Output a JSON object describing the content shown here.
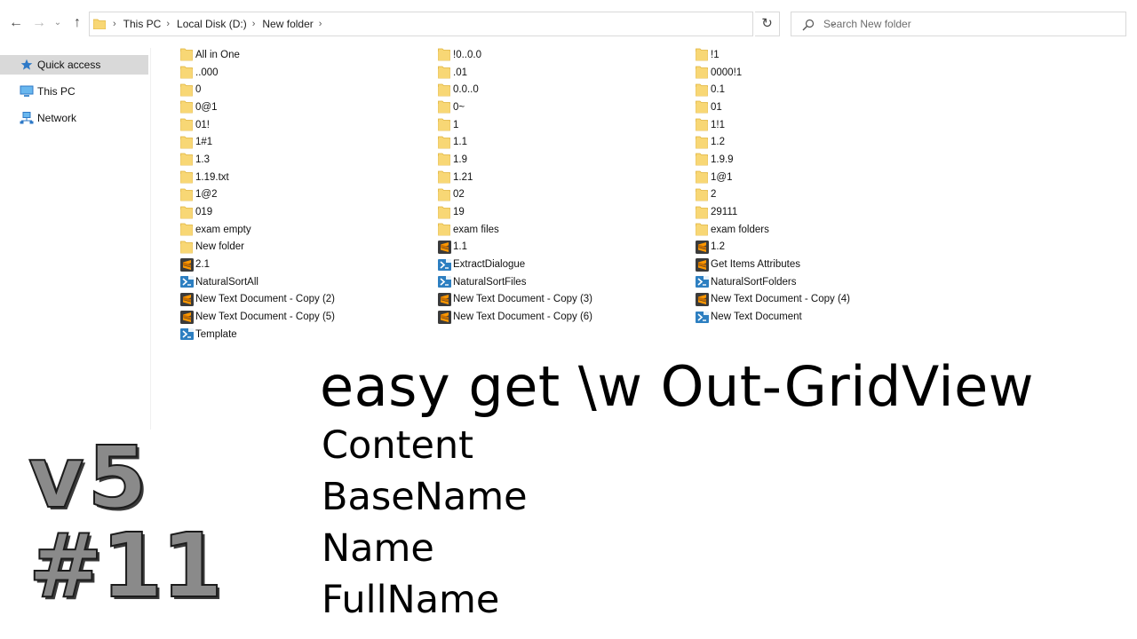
{
  "address_bar": {
    "breadcrumbs": [
      "This PC",
      "Local Disk (D:)",
      "New folder"
    ],
    "search_placeholder": "Search New folder"
  },
  "nav_pane": {
    "items": [
      {
        "label": "Quick access",
        "icon": "star-icon",
        "selected": true
      },
      {
        "label": "This PC",
        "icon": "computer-icon",
        "selected": false
      },
      {
        "label": "Network",
        "icon": "network-icon",
        "selected": false
      }
    ]
  },
  "files": {
    "columns": [
      [
        {
          "name": "All in One",
          "type": "folder"
        },
        {
          "name": "..000",
          "type": "folder"
        },
        {
          "name": "0",
          "type": "folder"
        },
        {
          "name": "0@1",
          "type": "folder"
        },
        {
          "name": "01!",
          "type": "folder"
        },
        {
          "name": "1#1",
          "type": "folder"
        },
        {
          "name": "1.3",
          "type": "folder"
        },
        {
          "name": "1.19.txt",
          "type": "folder"
        },
        {
          "name": "1@2",
          "type": "folder"
        },
        {
          "name": "019",
          "type": "folder"
        },
        {
          "name": "exam empty",
          "type": "folder"
        },
        {
          "name": "New folder",
          "type": "folder"
        },
        {
          "name": "2.1",
          "type": "sublime"
        },
        {
          "name": "NaturalSortAll",
          "type": "powershell"
        },
        {
          "name": "New Text Document - Copy (2)",
          "type": "sublime"
        },
        {
          "name": "New Text Document - Copy (5)",
          "type": "sublime"
        },
        {
          "name": "Template",
          "type": "powershell"
        }
      ],
      [
        {
          "name": "!0..0.0",
          "type": "folder"
        },
        {
          "name": ".01",
          "type": "folder"
        },
        {
          "name": "0.0..0",
          "type": "folder"
        },
        {
          "name": "0~",
          "type": "folder"
        },
        {
          "name": "1",
          "type": "folder"
        },
        {
          "name": "1.1",
          "type": "folder"
        },
        {
          "name": "1.9",
          "type": "folder"
        },
        {
          "name": "1.21",
          "type": "folder"
        },
        {
          "name": "02",
          "type": "folder"
        },
        {
          "name": "19",
          "type": "folder"
        },
        {
          "name": "exam files",
          "type": "folder"
        },
        {
          "name": "1.1",
          "type": "sublime"
        },
        {
          "name": "ExtractDialogue",
          "type": "powershell"
        },
        {
          "name": "NaturalSortFiles",
          "type": "powershell"
        },
        {
          "name": "New Text Document - Copy (3)",
          "type": "sublime"
        },
        {
          "name": "New Text Document - Copy (6)",
          "type": "sublime"
        }
      ],
      [
        {
          "name": "!1",
          "type": "folder"
        },
        {
          "name": "0000!1",
          "type": "folder"
        },
        {
          "name": "0.1",
          "type": "folder"
        },
        {
          "name": "01",
          "type": "folder"
        },
        {
          "name": "1!1",
          "type": "folder"
        },
        {
          "name": "1.2",
          "type": "folder"
        },
        {
          "name": "1.9.9",
          "type": "folder"
        },
        {
          "name": "1@1",
          "type": "folder"
        },
        {
          "name": "2",
          "type": "folder"
        },
        {
          "name": "29111",
          "type": "folder"
        },
        {
          "name": "exam folders",
          "type": "folder"
        },
        {
          "name": "1.2",
          "type": "sublime"
        },
        {
          "name": "Get Items Attributes",
          "type": "sublime"
        },
        {
          "name": "NaturalSortFolders",
          "type": "powershell"
        },
        {
          "name": "New Text Document - Copy (4)",
          "type": "sublime"
        },
        {
          "name": "New Text Document",
          "type": "powershell"
        }
      ]
    ]
  },
  "overlay": {
    "headline": "easy get \\w Out-GridView",
    "properties": [
      "Content",
      "BaseName",
      "Name",
      "FullName"
    ],
    "badge_version": "v5",
    "badge_number": "#11"
  },
  "colors": {
    "folder": "#f8d775",
    "folder_dark": "#e0b33a",
    "selected_nav": "#d9d9d9",
    "sublime_bg": "#3b3b3b",
    "sublime_accent": "#ff9800",
    "powershell_bg": "#2d7fc1"
  }
}
